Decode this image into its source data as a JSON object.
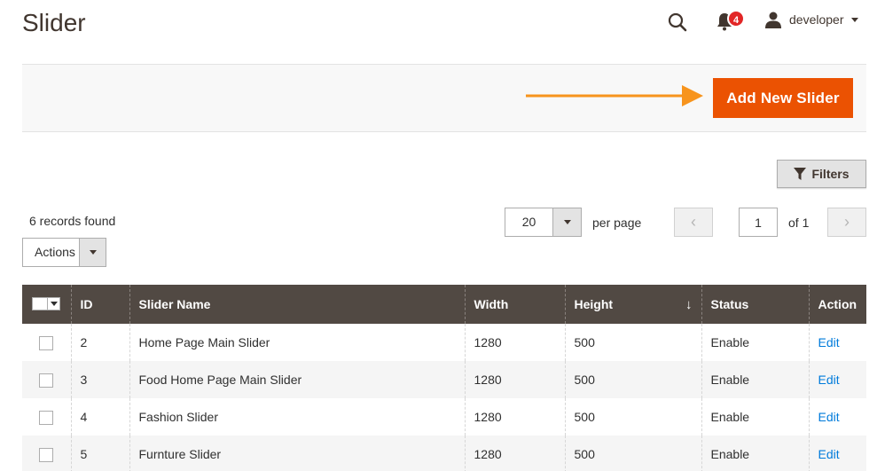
{
  "header": {
    "title": "Slider",
    "notifications_count": "4",
    "username": "developer"
  },
  "action_bar": {
    "add_button": "Add New Slider"
  },
  "grid_controls": {
    "filters_label": "Filters",
    "records_found": "6 records found",
    "actions_label": "Actions",
    "per_page_value": "20",
    "per_page_label": "per page",
    "current_page": "1",
    "total_pages_label": "of 1",
    "prev_symbol": "‹",
    "next_symbol": "›"
  },
  "table": {
    "columns": [
      "ID",
      "Slider Name",
      "Width",
      "Height",
      "Status",
      "Action"
    ],
    "sort_indicator": "↓",
    "rows": [
      {
        "id": "2",
        "name": "Home Page Main Slider",
        "width": "1280",
        "height": "500",
        "status": "Enable",
        "action": "Edit"
      },
      {
        "id": "3",
        "name": "Food Home Page Main Slider",
        "width": "1280",
        "height": "500",
        "status": "Enable",
        "action": "Edit"
      },
      {
        "id": "4",
        "name": "Fashion Slider",
        "width": "1280",
        "height": "500",
        "status": "Enable",
        "action": "Edit"
      },
      {
        "id": "5",
        "name": "Furnture Slider",
        "width": "1280",
        "height": "500",
        "status": "Enable",
        "action": "Edit"
      }
    ]
  },
  "colors": {
    "accent": "#eb5202",
    "arrow": "#f7941d",
    "header_bg": "#514943",
    "link": "#007bdb",
    "badge": "#e22626"
  },
  "icons": {
    "search": "search-icon",
    "bell": "bell-icon",
    "user": "user-icon",
    "filter": "filter-icon",
    "arrow": "right-arrow-icon"
  }
}
